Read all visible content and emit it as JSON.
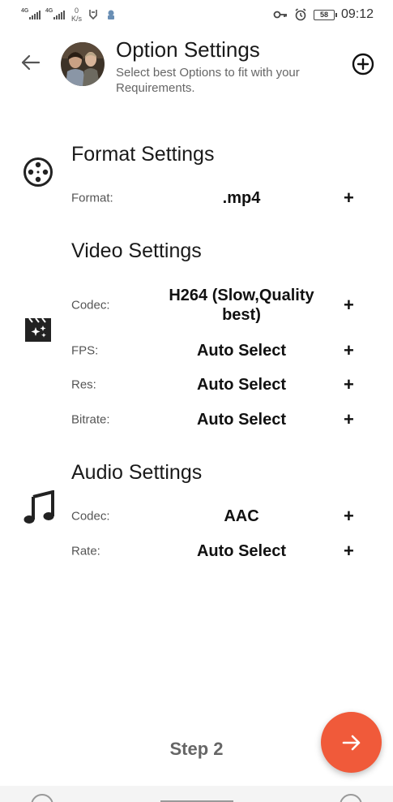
{
  "status_bar": {
    "network_1": "4G",
    "network_2": "4G",
    "speed_value": "0",
    "speed_unit": "K/s",
    "battery": "58",
    "time": "09:12"
  },
  "header": {
    "title": "Option Settings",
    "subtitle": "Select best Options to fit with your Requirements."
  },
  "format_section": {
    "title": "Format Settings",
    "icon": "film-reel-icon",
    "rows": [
      {
        "label": "Format:",
        "value": ".mp4",
        "action": "+"
      }
    ]
  },
  "video_section": {
    "title": "Video Settings",
    "icon": "movie-effects-icon",
    "rows": [
      {
        "label": "Codec:",
        "value": "H264 (Slow,Quality best)",
        "action": "+"
      },
      {
        "label": "FPS:",
        "value": "Auto Select",
        "action": "+"
      },
      {
        "label": "Res:",
        "value": "Auto Select",
        "action": "+"
      },
      {
        "label": "Bitrate:",
        "value": "Auto Select",
        "action": "+"
      }
    ]
  },
  "audio_section": {
    "title": "Audio Settings",
    "icon": "music-note-icon",
    "rows": [
      {
        "label": "Codec:",
        "value": "AAC",
        "action": "+"
      },
      {
        "label": "Rate:",
        "value": "Auto Select",
        "action": "+"
      }
    ]
  },
  "footer": {
    "step": "Step 2",
    "next_icon": "arrow-right-icon"
  },
  "colors": {
    "accent": "#f05a3a",
    "text_primary": "#1a1a1a",
    "text_secondary": "#666666"
  }
}
